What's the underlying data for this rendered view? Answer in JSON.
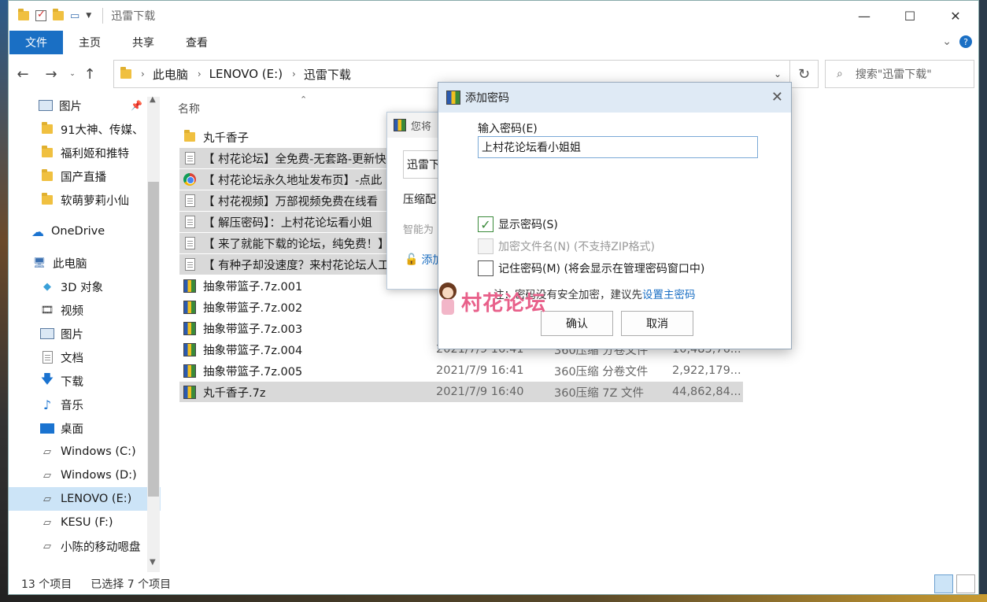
{
  "window": {
    "title": "迅雷下载",
    "controls": {
      "minimize": "—",
      "maximize": "☐",
      "close": "✕"
    }
  },
  "ribbon": {
    "tabs": [
      "文件",
      "主页",
      "共享",
      "查看"
    ]
  },
  "address": {
    "crumbs": [
      "此电脑",
      "LENOVO (E:)",
      "迅雷下载"
    ],
    "search_placeholder": "搜索\"迅雷下载\""
  },
  "sidebar": {
    "items": [
      {
        "label": "图片",
        "icon": "pictures-icon",
        "pinned": true
      },
      {
        "label": "91大神、传媒、",
        "icon": "folder-icon"
      },
      {
        "label": "福利姬和推特",
        "icon": "folder-icon"
      },
      {
        "label": "国产直播",
        "icon": "folder-icon"
      },
      {
        "label": "软萌萝莉小仙",
        "icon": "folder-icon"
      },
      {
        "label": "OneDrive",
        "icon": "onedrive-icon"
      },
      {
        "label": "此电脑",
        "icon": "this-pc-icon"
      },
      {
        "label": "3D 对象",
        "icon": "3d-objects-icon"
      },
      {
        "label": "视频",
        "icon": "videos-icon"
      },
      {
        "label": "图片",
        "icon": "pictures-icon"
      },
      {
        "label": "文档",
        "icon": "documents-icon"
      },
      {
        "label": "下载",
        "icon": "downloads-icon"
      },
      {
        "label": "音乐",
        "icon": "music-icon"
      },
      {
        "label": "桌面",
        "icon": "desktop-icon"
      },
      {
        "label": "Windows (C:)",
        "icon": "drive-icon"
      },
      {
        "label": "Windows (D:)",
        "icon": "drive-icon"
      },
      {
        "label": "LENOVO (E:)",
        "icon": "drive-icon",
        "selected": true
      },
      {
        "label": "KESU (F:)",
        "icon": "drive-icon"
      },
      {
        "label": "小陈的移动嗯盘",
        "icon": "drive-icon"
      }
    ]
  },
  "file_list": {
    "column_name": "名称",
    "rows": [
      {
        "name": "丸千香子",
        "icon": "folder-icon",
        "date": "",
        "type": "",
        "size": "",
        "selected": false
      },
      {
        "name": "【 村花论坛】全免费-无套路-更新快",
        "icon": "text-file-icon",
        "date": "",
        "type": "",
        "size": "",
        "selected": true
      },
      {
        "name": "【 村花论坛永久地址发布页】-点此",
        "icon": "chrome-icon",
        "date": "",
        "type": "",
        "size": "",
        "selected": true
      },
      {
        "name": "【 村花视频】万部视频免费在线看",
        "icon": "text-file-icon",
        "date": "",
        "type": "",
        "size": "",
        "selected": true
      },
      {
        "name": "【 解压密码】：上村花论坛看小姐",
        "icon": "text-file-icon",
        "date": "",
        "type": "",
        "size": "",
        "selected": true
      },
      {
        "name": "【 来了就能下载的论坛，纯免费！】",
        "icon": "text-file-icon",
        "date": "",
        "type": "",
        "size": "",
        "selected": true
      },
      {
        "name": "【 有种子却没速度？来村花论坛人工",
        "icon": "text-file-icon",
        "date": "",
        "type": "",
        "size": "",
        "selected": true
      },
      {
        "name": "抽象带篮子.7z.001",
        "icon": "archive-icon",
        "date": "",
        "type": "",
        "size": "",
        "selected": false
      },
      {
        "name": "抽象带篮子.7z.002",
        "icon": "archive-icon",
        "date": "",
        "type": "",
        "size": "",
        "selected": false
      },
      {
        "name": "抽象带篮子.7z.003",
        "icon": "archive-icon",
        "date": "",
        "type": "",
        "size": "",
        "selected": false
      },
      {
        "name": "抽象带篮子.7z.004",
        "icon": "archive-icon",
        "date": "2021/7/9 16:41",
        "type": "360压缩 分卷文件",
        "size": "10,485,76...",
        "selected": false
      },
      {
        "name": "抽象带篮子.7z.005",
        "icon": "archive-icon",
        "date": "2021/7/9 16:41",
        "type": "360压缩 分卷文件",
        "size": "2,922,179...",
        "selected": false
      },
      {
        "name": "丸千香子.7z",
        "icon": "archive-icon",
        "date": "2021/7/9 16:40",
        "type": "360压缩 7Z 文件",
        "size": "44,862,84...",
        "selected": true
      }
    ]
  },
  "status": {
    "count": "13 个项目",
    "selected": "已选择 7 个项目"
  },
  "back_dialog": {
    "title": "您将",
    "field": "迅雷下",
    "label1": "压缩配",
    "label2": "智能为",
    "link": "添加"
  },
  "password_dialog": {
    "title": "添加密码",
    "input_label": "输入密码(E)",
    "input_value": "上村花论坛看小姐姐",
    "show_password": "显示密码(S)",
    "encrypt_names": "加密文件名(N) (不支持ZIP格式)",
    "remember": "记住密码(M) (将会显示在管理密码窗口中)",
    "note_prefix": "注：密码没有安全加密，建议先",
    "note_link": "设置主密码",
    "ok": "确认",
    "cancel": "取消",
    "show_password_checked": true
  },
  "watermark": {
    "text": "村花论坛"
  }
}
